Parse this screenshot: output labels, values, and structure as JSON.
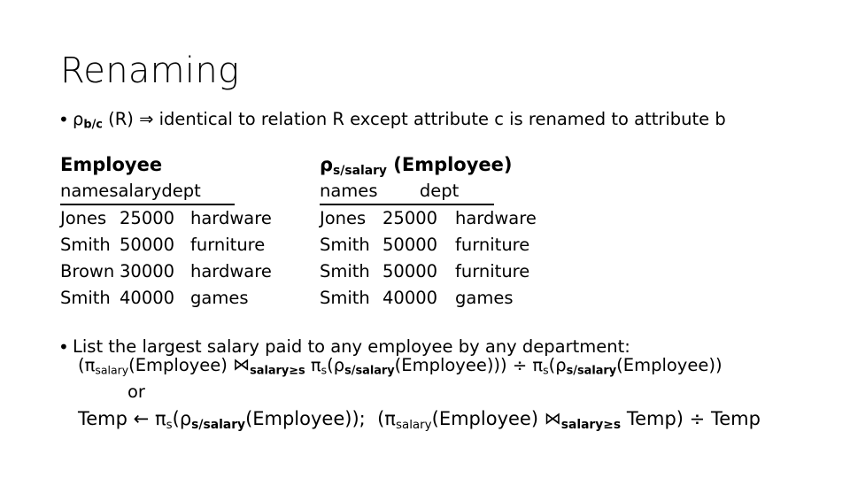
{
  "slide": {
    "title": "Renaming",
    "background_color": "#ffffff",
    "text_color": "#000000"
  },
  "bullets": [
    {
      "id": "rename-definition",
      "marker": "•",
      "rho": "ρ",
      "rho_subscript": "b/c",
      "text_after": " (R) ⇒ identical to relation R except attribute c is renamed to attribute b",
      "plain_text": "ρb/c (R) ⇒ identical to relation R except attribute c is renamed to attribute b"
    },
    {
      "id": "list-largest-salary",
      "marker": "•",
      "text": "List the largest salary paid to any employee by any department:"
    }
  ],
  "tables": [
    {
      "id": "employee",
      "title_plain": "Employee",
      "title_rho": "",
      "title_rho_subscript": "",
      "title_suffix": "",
      "columns": [
        "name",
        "salary",
        "dept"
      ],
      "rows": [
        [
          "Jones",
          "25000",
          "hardware"
        ],
        [
          "Smith",
          "50000",
          "furniture"
        ],
        [
          "Brown",
          "30000",
          "hardware"
        ],
        [
          "Smith",
          "40000",
          "games"
        ]
      ]
    },
    {
      "id": "renamed",
      "title_plain": "",
      "title_rho": "ρ",
      "title_rho_subscript": "s/salary",
      "title_suffix": " (Employee)",
      "columns": [
        "name",
        "s",
        "dept"
      ],
      "rows": [
        [
          "Jones",
          "25000",
          "hardware"
        ],
        [
          "Smith",
          "50000",
          "furniture"
        ],
        [
          "Smith",
          "50000",
          "furniture"
        ],
        [
          "Smith",
          "40000",
          "games"
        ]
      ]
    }
  ],
  "formulas": {
    "line1": {
      "plain": "(πsalary(Employee) ⋈salary≥s πs(ρs/salary(Employee))) ÷ πs(ρs/salary(Employee))",
      "p1_open": "(",
      "pi1": "π",
      "pi1_sub": "salary",
      "rel1": "(Employee) ",
      "join": "⋈",
      "join_sub": "salary≥s",
      "pi2": "π",
      "pi2_sub": "s",
      "paren2": "(",
      "rho1": "ρ",
      "rho1_sub": "s/salary",
      "rel2": "(Employee)))",
      "divide": " ÷ ",
      "pi3": "π",
      "pi3_sub": "s",
      "paren3": "(",
      "rho2": "ρ",
      "rho2_sub": "s/salary",
      "rel3": "(Employee))"
    },
    "or_label": "or",
    "line2": {
      "plain": "Temp ← πs(ρs/salary(Employee));  (πsalary(Employee) ⋈salary≥s Temp) ÷ Temp",
      "temp": "Temp ",
      "arrow": "←",
      "pi1": "π",
      "pi1_sub": "s",
      "paren1": "(",
      "rho1": "ρ",
      "rho1_sub": "s/salary",
      "rel1": "(Employee));",
      "gap": "  ",
      "p2_open": "(",
      "pi2": "π",
      "pi2_sub": "salary",
      "rel2": "(Employee) ",
      "join": "⋈",
      "join_sub": "salary≥s",
      "temp2": " Temp)",
      "divide": " ÷ ",
      "temp3": " Temp"
    }
  }
}
